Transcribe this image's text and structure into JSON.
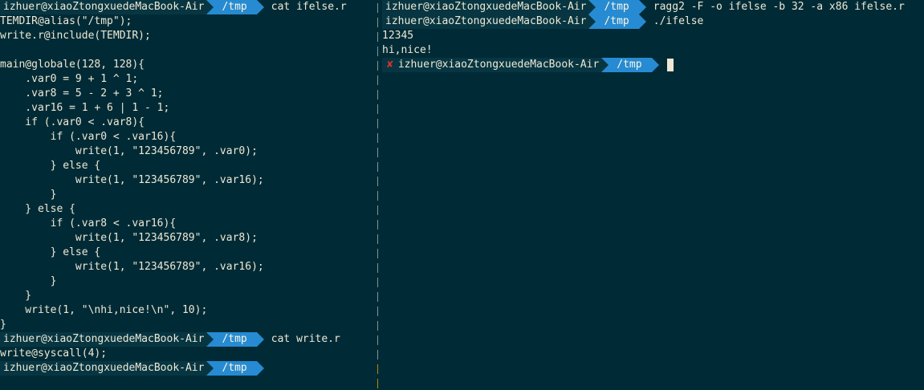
{
  "left_pane": {
    "lines": [
      {
        "type": "prompt",
        "host": "izhuer@xiaoZtongxuedeMacBook-Air",
        "dir": "/tmp",
        "cmd": "cat ifelse.r"
      },
      {
        "type": "text",
        "text": "TEMDIR@alias(\"/tmp\");"
      },
      {
        "type": "text",
        "text": "write.r@include(TEMDIR);"
      },
      {
        "type": "text",
        "text": ""
      },
      {
        "type": "text",
        "text": "main@globale(128, 128){"
      },
      {
        "type": "text",
        "text": "    .var0 = 9 + 1 ^ 1;"
      },
      {
        "type": "text",
        "text": "    .var8 = 5 - 2 + 3 ^ 1;"
      },
      {
        "type": "text",
        "text": "    .var16 = 1 + 6 | 1 - 1;"
      },
      {
        "type": "text",
        "text": "    if (.var0 < .var8){"
      },
      {
        "type": "text",
        "text": "        if (.var0 < .var16){"
      },
      {
        "type": "text",
        "text": "            write(1, \"123456789\", .var0);"
      },
      {
        "type": "text",
        "text": "        } else {"
      },
      {
        "type": "text",
        "text": "            write(1, \"123456789\", .var16);"
      },
      {
        "type": "text",
        "text": "        }"
      },
      {
        "type": "text",
        "text": "    } else {"
      },
      {
        "type": "text",
        "text": "        if (.var8 < .var16){"
      },
      {
        "type": "text",
        "text": "            write(1, \"123456789\", .var8);"
      },
      {
        "type": "text",
        "text": "        } else {"
      },
      {
        "type": "text",
        "text": "            write(1, \"123456789\", .var16);"
      },
      {
        "type": "text",
        "text": "        }"
      },
      {
        "type": "text",
        "text": "    }"
      },
      {
        "type": "text",
        "text": "    write(1, \"\\nhi,nice!\\n\", 10);"
      },
      {
        "type": "text",
        "text": "}"
      },
      {
        "type": "prompt",
        "host": "izhuer@xiaoZtongxuedeMacBook-Air",
        "dir": "/tmp",
        "cmd": "cat write.r"
      },
      {
        "type": "text",
        "text": "write@syscall(4);"
      },
      {
        "type": "prompt",
        "host": "izhuer@xiaoZtongxuedeMacBook-Air",
        "dir": "/tmp",
        "cmd": ""
      }
    ]
  },
  "right_pane": {
    "lines": [
      {
        "type": "prompt",
        "host": "izhuer@xiaoZtongxuedeMacBook-Air",
        "dir": "/tmp",
        "cmd": "ragg2 -F -o ifelse -b 32 -a x86 ifelse.r"
      },
      {
        "type": "prompt",
        "host": "izhuer@xiaoZtongxuedeMacBook-Air",
        "dir": "/tmp",
        "cmd": "./ifelse"
      },
      {
        "type": "text",
        "text": "12345"
      },
      {
        "type": "text",
        "text": "hi,nice!"
      },
      {
        "type": "prompt",
        "host": "izhuer@xiaoZtongxuedeMacBook-Air",
        "dir": "/tmp",
        "cmd": "",
        "error_icon": "✘",
        "cursor": true
      }
    ]
  },
  "colors": {
    "background": "#002b36",
    "host_segment": "#073642",
    "dir_segment": "#268bd2",
    "error": "#dc322f",
    "active_divider": "#b58900"
  },
  "icons": {
    "prompt_separator": "powerline-arrow-icon",
    "error": "error-x-icon"
  }
}
